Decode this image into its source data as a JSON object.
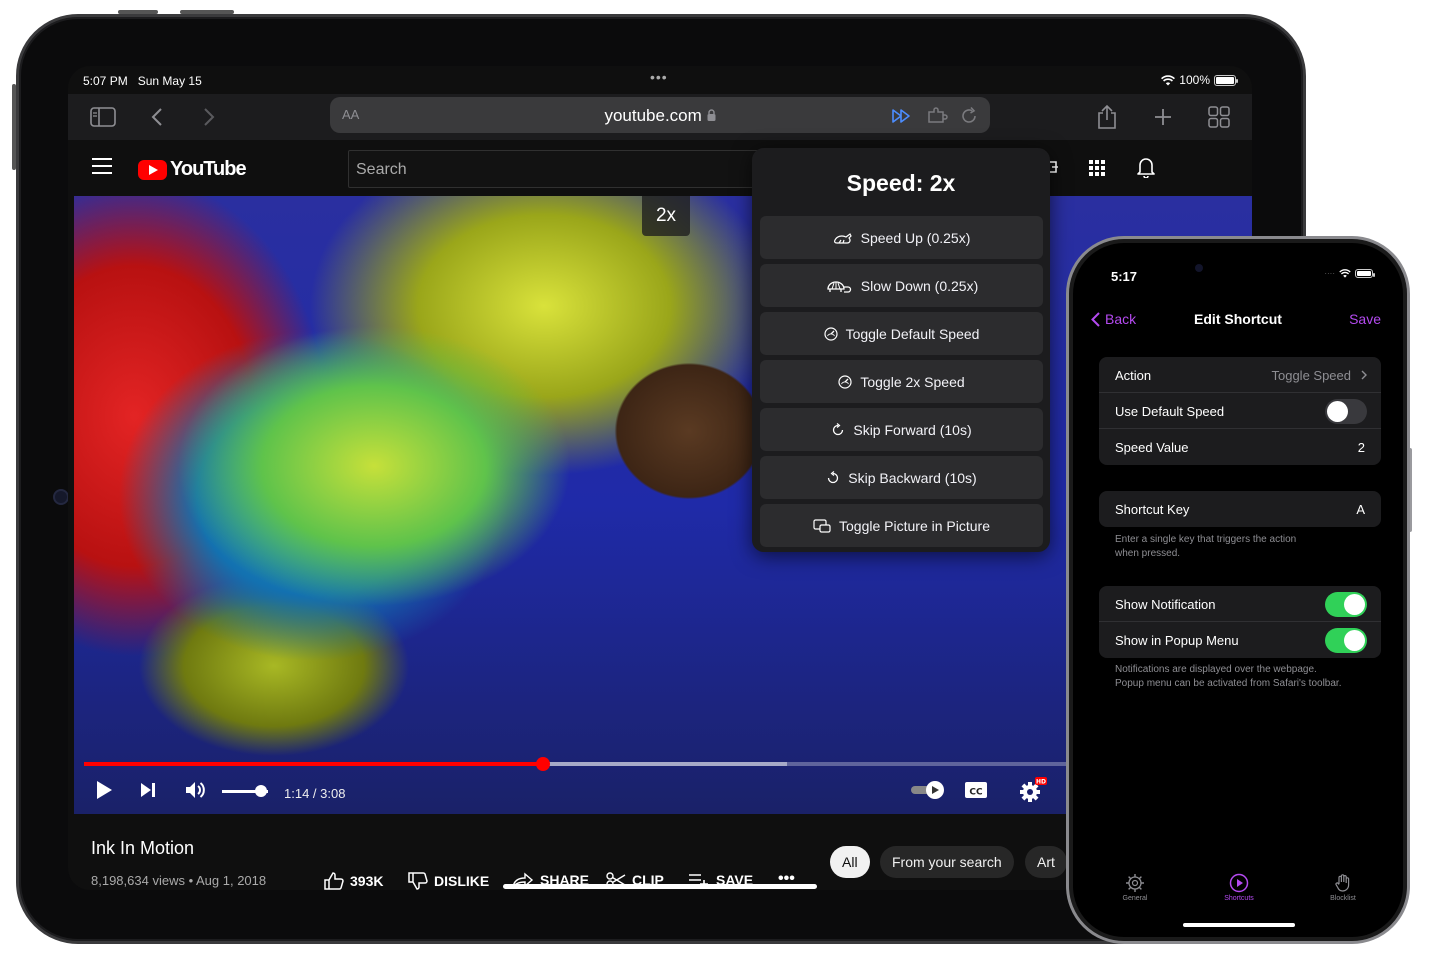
{
  "ipad": {
    "status": {
      "time": "5:07 PM",
      "date": "Sun May 15",
      "battery": "100%"
    },
    "safari": {
      "aa": "AA",
      "url": "youtube.com"
    },
    "youtube": {
      "logo_text": "YouTube",
      "search_placeholder": "Search",
      "speed_badge": "2x",
      "player": {
        "time": "1:14 / 3:08",
        "progress": 0.4632,
        "buffered": 0.71,
        "volume": 0.85,
        "hd_badge": "HD"
      },
      "video": {
        "title": "Ink In Motion",
        "meta": "8,198,634 views • Aug 1, 2018",
        "likes": "393K",
        "dislike": "DISLIKE",
        "share": "SHARE",
        "clip": "CLIP",
        "save": "SAVE"
      },
      "chips": [
        "All",
        "From your search",
        "Art"
      ]
    },
    "popup": {
      "title": "Speed: 2x",
      "items": [
        {
          "label": "Speed Up (0.25x)",
          "icon": "rabbit-icon"
        },
        {
          "label": "Slow Down (0.25x)",
          "icon": "turtle-icon"
        },
        {
          "label": "Toggle Default Speed",
          "icon": "gauge-icon"
        },
        {
          "label": "Toggle 2x Speed",
          "icon": "gauge-icon"
        },
        {
          "label": "Skip Forward (10s)",
          "icon": "rotate-cw-icon"
        },
        {
          "label": "Skip Backward (10s)",
          "icon": "rotate-ccw-icon"
        },
        {
          "label": "Toggle Picture in Picture",
          "icon": "pip-icon"
        }
      ]
    }
  },
  "iphone": {
    "status": {
      "time": "5:17"
    },
    "nav": {
      "back": "Back",
      "title": "Edit Shortcut",
      "save": "Save"
    },
    "action_group": {
      "action_label": "Action",
      "action_value": "Toggle Speed",
      "default_speed_label": "Use Default Speed",
      "default_speed_on": false,
      "speed_value_label": "Speed Value",
      "speed_value": "2"
    },
    "key_group": {
      "key_label": "Shortcut Key",
      "key_value": "A",
      "footnote_line1": "Enter a single key that triggers the action",
      "footnote_line2": "when pressed."
    },
    "notify_group": {
      "show_notification_label": "Show Notification",
      "show_notification_on": true,
      "show_popup_label": "Show in Popup Menu",
      "show_popup_on": true,
      "footnote_line1": "Notifications are displayed over the webpage.",
      "footnote_line2": "Popup menu can be activated from Safari's toolbar."
    },
    "tabs": [
      {
        "label": "General",
        "icon": "gear-icon",
        "active": false
      },
      {
        "label": "Shortcuts",
        "icon": "play-circle-icon",
        "active": true
      },
      {
        "label": "Blocklist",
        "icon": "hand-icon",
        "active": false
      }
    ]
  },
  "colors": {
    "accent": "#b44af0",
    "youtube_red": "#ff0000",
    "toggle_on": "#30d158"
  }
}
